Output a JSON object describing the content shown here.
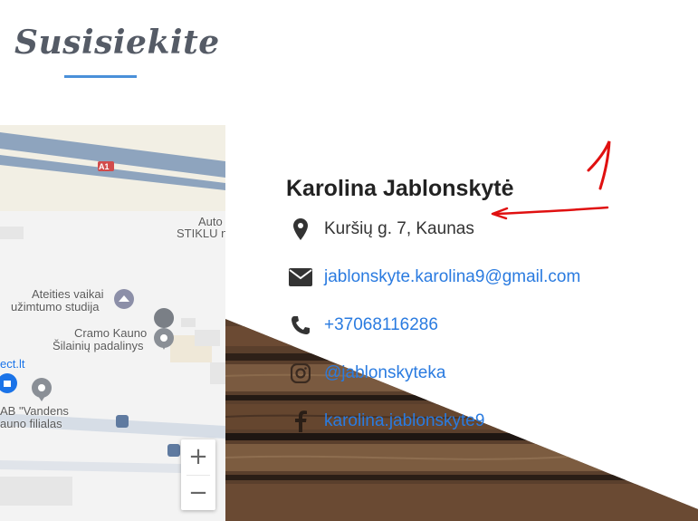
{
  "heading": {
    "title": "Susisiekite"
  },
  "map": {
    "road_shield": "A1",
    "labels": {
      "auto": "Auto",
      "stiklu": "STIKLU n",
      "ateities_1": "Ateities vaikai",
      "ateities_2": "užimtumo studija",
      "cramo_1": "Cramo Kauno",
      "cramo_2": "Šilainių padalinys",
      "ect": "ect.lt",
      "vandens_1": "AB \"Vandens",
      "vandens_2": "auno filialas"
    },
    "zoom_in": "+",
    "zoom_out": "−"
  },
  "contact": {
    "name": "Karolina Jablonskytė",
    "address": "Kuršių g. 7, Kaunas",
    "email": "jablonskyte.karolina9@gmail.com",
    "phone": "+37068116286",
    "instagram": "@jablonskyteka",
    "facebook": "karolina.jablonskyte9"
  },
  "icons": {
    "address": "map-marker-icon",
    "email": "envelope-icon",
    "phone": "phone-icon",
    "instagram": "instagram-icon",
    "facebook": "facebook-icon"
  },
  "colors": {
    "accent": "#4a90d9",
    "link": "#2a7be0",
    "annotation": "#e01010"
  }
}
